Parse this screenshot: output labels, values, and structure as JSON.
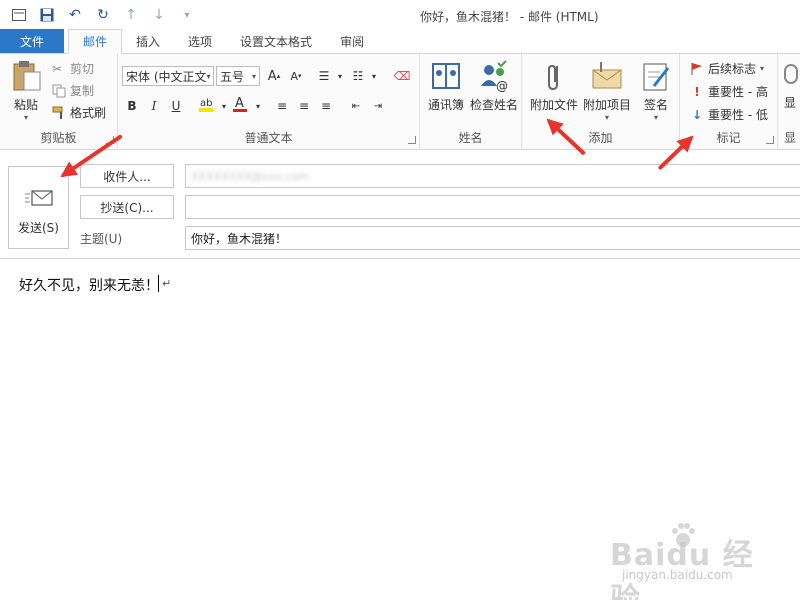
{
  "window": {
    "title": "你好，鱼木混猪！ - 邮件 (HTML)"
  },
  "tabs": [
    "文件",
    "邮件",
    "插入",
    "选项",
    "设置文本格式",
    "审阅"
  ],
  "clipboard": {
    "paste": "粘贴",
    "cut": "剪切",
    "copy": "复制",
    "format_painter": "格式刷",
    "group": "剪贴板"
  },
  "font": {
    "family": "宋体 (中文正文",
    "size": "五号",
    "group": "普通文本",
    "bold": "B",
    "italic": "I",
    "underline": "U"
  },
  "names": {
    "address_book": "通讯簿",
    "check_names": "检查姓名",
    "group": "姓名"
  },
  "include": {
    "attach_file": "附加文件",
    "attach_item": "附加项目",
    "signature": "签名",
    "group": "添加"
  },
  "tags": {
    "follow_up": "后续标志",
    "high": "重要性 - 高",
    "low": "重要性 - 低",
    "group": "标记"
  },
  "partial_group": {
    "label": "显",
    "group": "显"
  },
  "compose": {
    "send": "发送(S)",
    "to_button": "收件人...",
    "cc_button": "抄送(C)...",
    "subject_label": "主题(U)",
    "to_value": "XXXXXXXX@xxx.com",
    "cc_value": "",
    "subject_value": "你好，鱼木混猪！",
    "body": "好久不见，别来无恙！"
  },
  "watermark": {
    "logo": "Baidu 经验",
    "url": "jingyan.baidu.com"
  },
  "colors": {
    "accent": "#2b78c8",
    "arrow": "#e8342a",
    "ribbon_bg": "#fbfbfb"
  }
}
